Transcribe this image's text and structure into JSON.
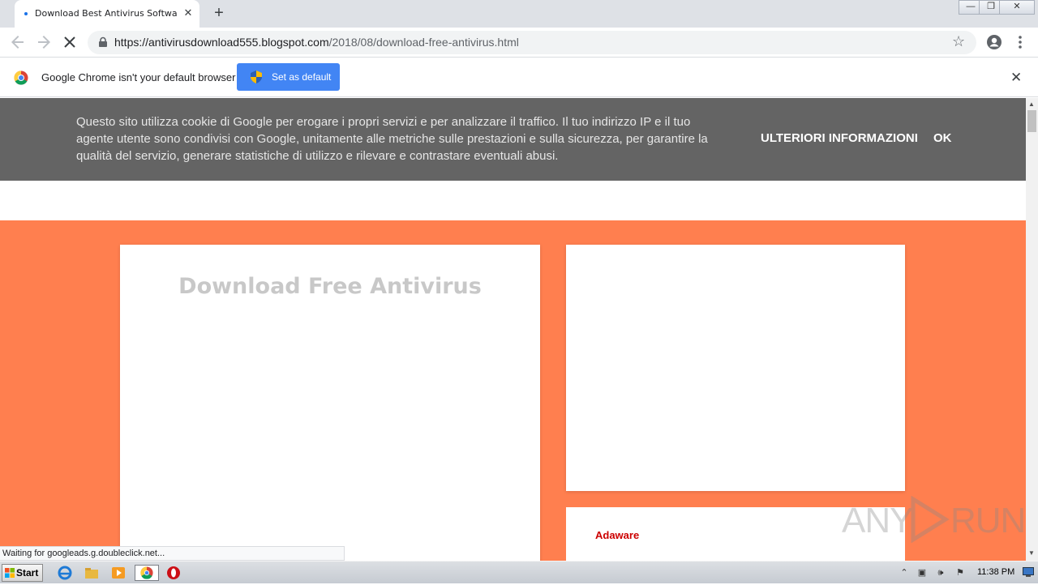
{
  "browser": {
    "tab_title": "Download Best Antivirus Software fo",
    "tab_close": "✕",
    "new_tab": "+",
    "url_host": "https://antivirusdownload555.blogspot.com",
    "url_path": "/2018/08/download-free-antivirus.html",
    "window_min": "—",
    "window_restore": "❐",
    "window_close": "✕"
  },
  "infobar": {
    "message": "Google Chrome isn't your default browser",
    "button": "Set as default",
    "close": "✕"
  },
  "cookie_banner": {
    "text": "Questo sito utilizza cookie di Google per erogare i propri servizi e per analizzare il traffico. Il tuo indirizzo IP e il tuo agente utente sono condivisi con Google, unitamente alle metriche sulle prestazioni e sulla sicurezza, per garantire la qualità del servizio, generare statistiche di utilizzo e rilevare e contrastare eventuali abusi.",
    "more_info": "ULTERIORI INFORMAZIONI",
    "ok": "OK"
  },
  "page": {
    "post_title": "Download Free Antivirus",
    "sidebar_link": "Adaware",
    "accent_color": "#ff7f4f"
  },
  "status_bar": "Waiting for googleads.g.doubleclick.net...",
  "taskbar": {
    "start": "Start",
    "clock": "11:38 PM"
  },
  "watermark": {
    "left": "ANY",
    "right": "RUN"
  }
}
